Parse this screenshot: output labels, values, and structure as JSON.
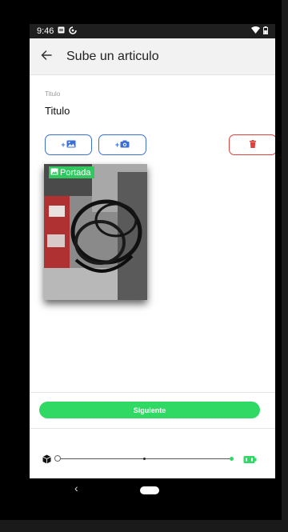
{
  "status_bar": {
    "time": "9:46",
    "icons": [
      "notification-icon",
      "sync-icon",
      "wifi-icon",
      "battery-icon"
    ]
  },
  "app_bar": {
    "title": "Sube un articulo",
    "back_icon": "arrow-left-icon"
  },
  "form": {
    "title_label": "Titulo",
    "title_value": "Titulo"
  },
  "actions": {
    "add_gallery_plus": "+",
    "add_camera_plus": "+",
    "add_gallery_icon": "add-photo-gallery-icon",
    "add_camera_icon": "add-camera-icon",
    "delete_icon": "trash-icon"
  },
  "photos": [
    {
      "cover_label": "Portada",
      "is_cover": true
    }
  ],
  "footer": {
    "next_label": "Siguiente"
  },
  "progress": {
    "start_icon": "cube-icon",
    "end_icon": "battery-icon",
    "current_step_fraction": 0.5
  },
  "colors": {
    "accent_green": "#2fd964",
    "outline_blue": "#3b6fd8",
    "delete_red": "#e0413d"
  }
}
